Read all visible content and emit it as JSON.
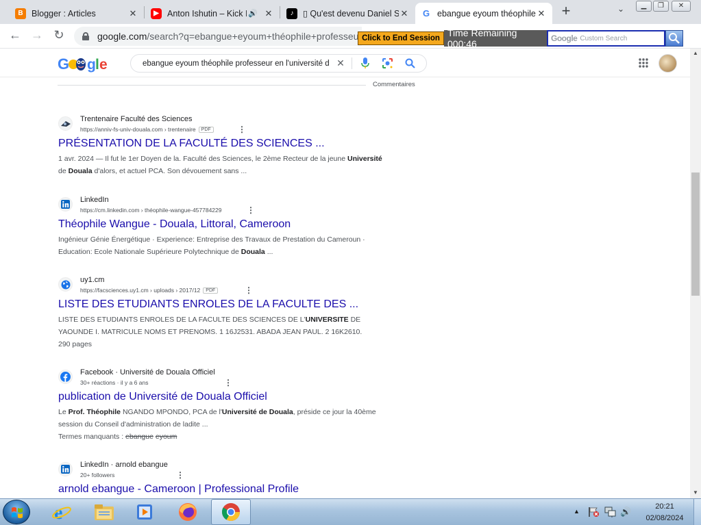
{
  "tabs": [
    {
      "title": "Blogger : Articles",
      "icon": "blogger-icon",
      "active": false
    },
    {
      "title": "Anton Ishutin – Kick I",
      "icon": "youtube-icon",
      "active": false
    },
    {
      "title": "▯ Qu'est devenu Daniel S",
      "icon": "tiktok-icon",
      "active": false
    },
    {
      "title": "ebangue eyoum théophile",
      "icon": "google-icon",
      "active": true
    }
  ],
  "browser": {
    "url_host": "google.com",
    "url_rest": "/search?q=ebangue+eyoum+théophile+professeur"
  },
  "overlay": {
    "end_session_label": "Click to End Session",
    "time_remaining": "Time Remaining 000:46",
    "custom_search_brand": "Google",
    "custom_search_placeholder": "Custom Search"
  },
  "google": {
    "query": "ebangue eyoum théophile professeur en l'université d",
    "comments_label": "Commentaires"
  },
  "results": [
    {
      "site": "Trentenaire Faculté des Sciences",
      "path": "https://anniv-fs-univ-douala.com › trentenaire",
      "badge": "PDF",
      "title": "PRÉSENTATION DE LA FACULTÉ DES SCIENCES ...",
      "snippet_html": "1 avr. 2024 — Il fut le 1er Doyen de la. Faculté des Sciences, le 2ème Recteur de la jeune <b>Université</b> de <b>Douala</b> d'alors, et actuel PCA. Son dévouement sans ...",
      "icon": "faculty-logo-icon"
    },
    {
      "site": "LinkedIn",
      "path": "https://cm.linkedin.com › théophile-wangue-457784229",
      "badge": "",
      "title": "Théophile Wangue - Douala, Littoral, Cameroon",
      "snippet_html": "Ingénieur Génie Énergétique · Experience: Entreprise des Travaux de Prestation du Cameroun · Education: Ecole Nationale Supérieure Polytechnique de <b>Douala</b> ...",
      "icon": "linkedin-icon"
    },
    {
      "site": "uy1.cm",
      "path": "https://facsciences.uy1.cm › uploads › 2017/12",
      "badge": "PDF",
      "title": "LISTE DES ETUDIANTS ENROLES DE LA FACULTE DES ...",
      "snippet_html": "LISTE DES ETUDIANTS ENROLES DE LA FACULTE DES SCIENCES DE L'<b>UNIVERSITE</b> DE YAOUNDE I. MATRICULE NOMS ET PRENOMS. 1 16J2531. ABADA JEAN PAUL. 2 16K2610.<br>290 pages",
      "icon": "globe-icon"
    },
    {
      "site": "Facebook · Université de Douala Officiel",
      "path": "30+ réactions · il y a 6 ans",
      "badge": "",
      "title": "publication de Université de Douala Officiel",
      "snippet_html": "Le <b>Prof. Théophile</b> NGANDO MPONDO, PCA de l'<b>Université de Douala</b>, préside ce jour la 40ème session du Conseil d'administration de ladite ...<br>Termes manquants : <span class=\"strike\">ebangue</span> <span class=\"strike\">eyoum</span>",
      "icon": "facebook-icon"
    },
    {
      "site": "LinkedIn · arnold ebangue",
      "path": "20+ followers",
      "badge": "",
      "title": "arnold ebangue - Cameroon | Professional Profile",
      "snippet_html": "",
      "icon": "linkedin-icon"
    }
  ],
  "taskbar": {
    "time": "20:21",
    "date": "02/08/2024"
  }
}
